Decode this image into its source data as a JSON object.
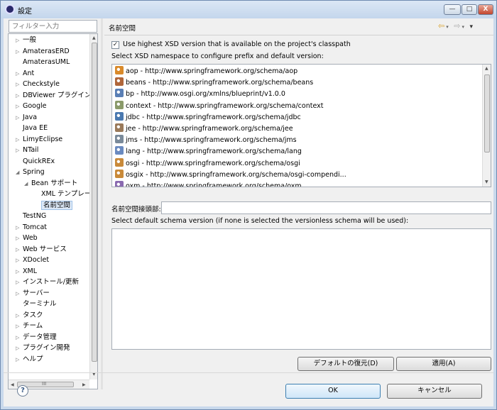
{
  "window": {
    "title": "設定",
    "minimize": "—",
    "maximize": "□",
    "close": "X"
  },
  "sidebar": {
    "filter_placeholder": "フィルター入力",
    "items": [
      {
        "label": "一般",
        "expander": "▷"
      },
      {
        "label": "AmaterasERD",
        "expander": "▷"
      },
      {
        "label": "AmaterasUML",
        "expander": ""
      },
      {
        "label": "Ant",
        "expander": "▷"
      },
      {
        "label": "Checkstyle",
        "expander": "▷"
      },
      {
        "label": "DBViewer プラグイン",
        "expander": "▷"
      },
      {
        "label": "Google",
        "expander": "▷"
      },
      {
        "label": "Java",
        "expander": "▷"
      },
      {
        "label": "Java EE",
        "expander": ""
      },
      {
        "label": "LimyEclipse",
        "expander": "▷"
      },
      {
        "label": "NTail",
        "expander": "▷"
      },
      {
        "label": "QuickREx",
        "expander": ""
      },
      {
        "label": "Spring",
        "expander": "◢"
      },
      {
        "label": "Bean サポート",
        "expander": "◢"
      },
      {
        "label": "XML テンプレー",
        "expander": ""
      },
      {
        "label": "名前空間",
        "expander": ""
      },
      {
        "label": "TestNG",
        "expander": ""
      },
      {
        "label": "Tomcat",
        "expander": "▷"
      },
      {
        "label": "Web",
        "expander": "▷"
      },
      {
        "label": "Web サービス",
        "expander": "▷"
      },
      {
        "label": "XDoclet",
        "expander": "▷"
      },
      {
        "label": "XML",
        "expander": "▷"
      },
      {
        "label": "インストール/更新",
        "expander": "▷"
      },
      {
        "label": "サーバー",
        "expander": "▷"
      },
      {
        "label": "ターミナル",
        "expander": ""
      },
      {
        "label": "タスク",
        "expander": "▷"
      },
      {
        "label": "チーム",
        "expander": "▷"
      },
      {
        "label": "データ管理",
        "expander": "▷"
      },
      {
        "label": "プラグイン開発",
        "expander": "▷"
      },
      {
        "label": "ヘルプ",
        "expander": "▷"
      }
    ],
    "selected_index": 15,
    "hscroll_grip": "III"
  },
  "page": {
    "title": "名前空間",
    "nav_back": "⇦",
    "nav_forward": "⇨",
    "nav_menu": "▾",
    "checkbox_checked": true,
    "checkbox_label": "Use highest XSD version that is available on the project's classpath",
    "ns_heading": "Select XSD namespace to configure prefix and default version:",
    "namespaces": [
      {
        "text": "aop - http://www.springframework.org/schema/aop",
        "icon_color": "#d98a2b"
      },
      {
        "text": "beans - http://www.springframework.org/schema/beans",
        "icon_color": "#b0663a"
      },
      {
        "text": "bp - http://www.osgi.org/xmlns/blueprint/v1.0.0",
        "icon_color": "#5a7fb5"
      },
      {
        "text": "context - http://www.springframework.org/schema/context",
        "icon_color": "#8a9a6a"
      },
      {
        "text": "jdbc - http://www.springframework.org/schema/jdbc",
        "icon_color": "#4a79b0"
      },
      {
        "text": "jee - http://www.springframework.org/schema/jee",
        "icon_color": "#9a7a5a"
      },
      {
        "text": "jms - http://www.springframework.org/schema/jms",
        "icon_color": "#7a8a9a"
      },
      {
        "text": "lang - http://www.springframework.org/schema/lang",
        "icon_color": "#6a8ac0"
      },
      {
        "text": "osgi - http://www.springframework.org/schema/osgi",
        "icon_color": "#c98a3a"
      },
      {
        "text": "osgix - http://www.springframework.org/schema/osgi-compendi...",
        "icon_color": "#c98a3a"
      },
      {
        "text": "oxm - http://www.springframework.org/schema/oxm",
        "icon_color": "#8a6ab0"
      }
    ],
    "prefix_label": "名前空間接頭部:",
    "prefix_value": "",
    "schema_heading": "Select default schema version (if none is selected the versionless schema will be used):",
    "restore_defaults": "デフォルトの復元(D)",
    "apply": "適用(A)"
  },
  "footer": {
    "help": "?",
    "ok": "OK",
    "cancel": "キャンセル"
  }
}
